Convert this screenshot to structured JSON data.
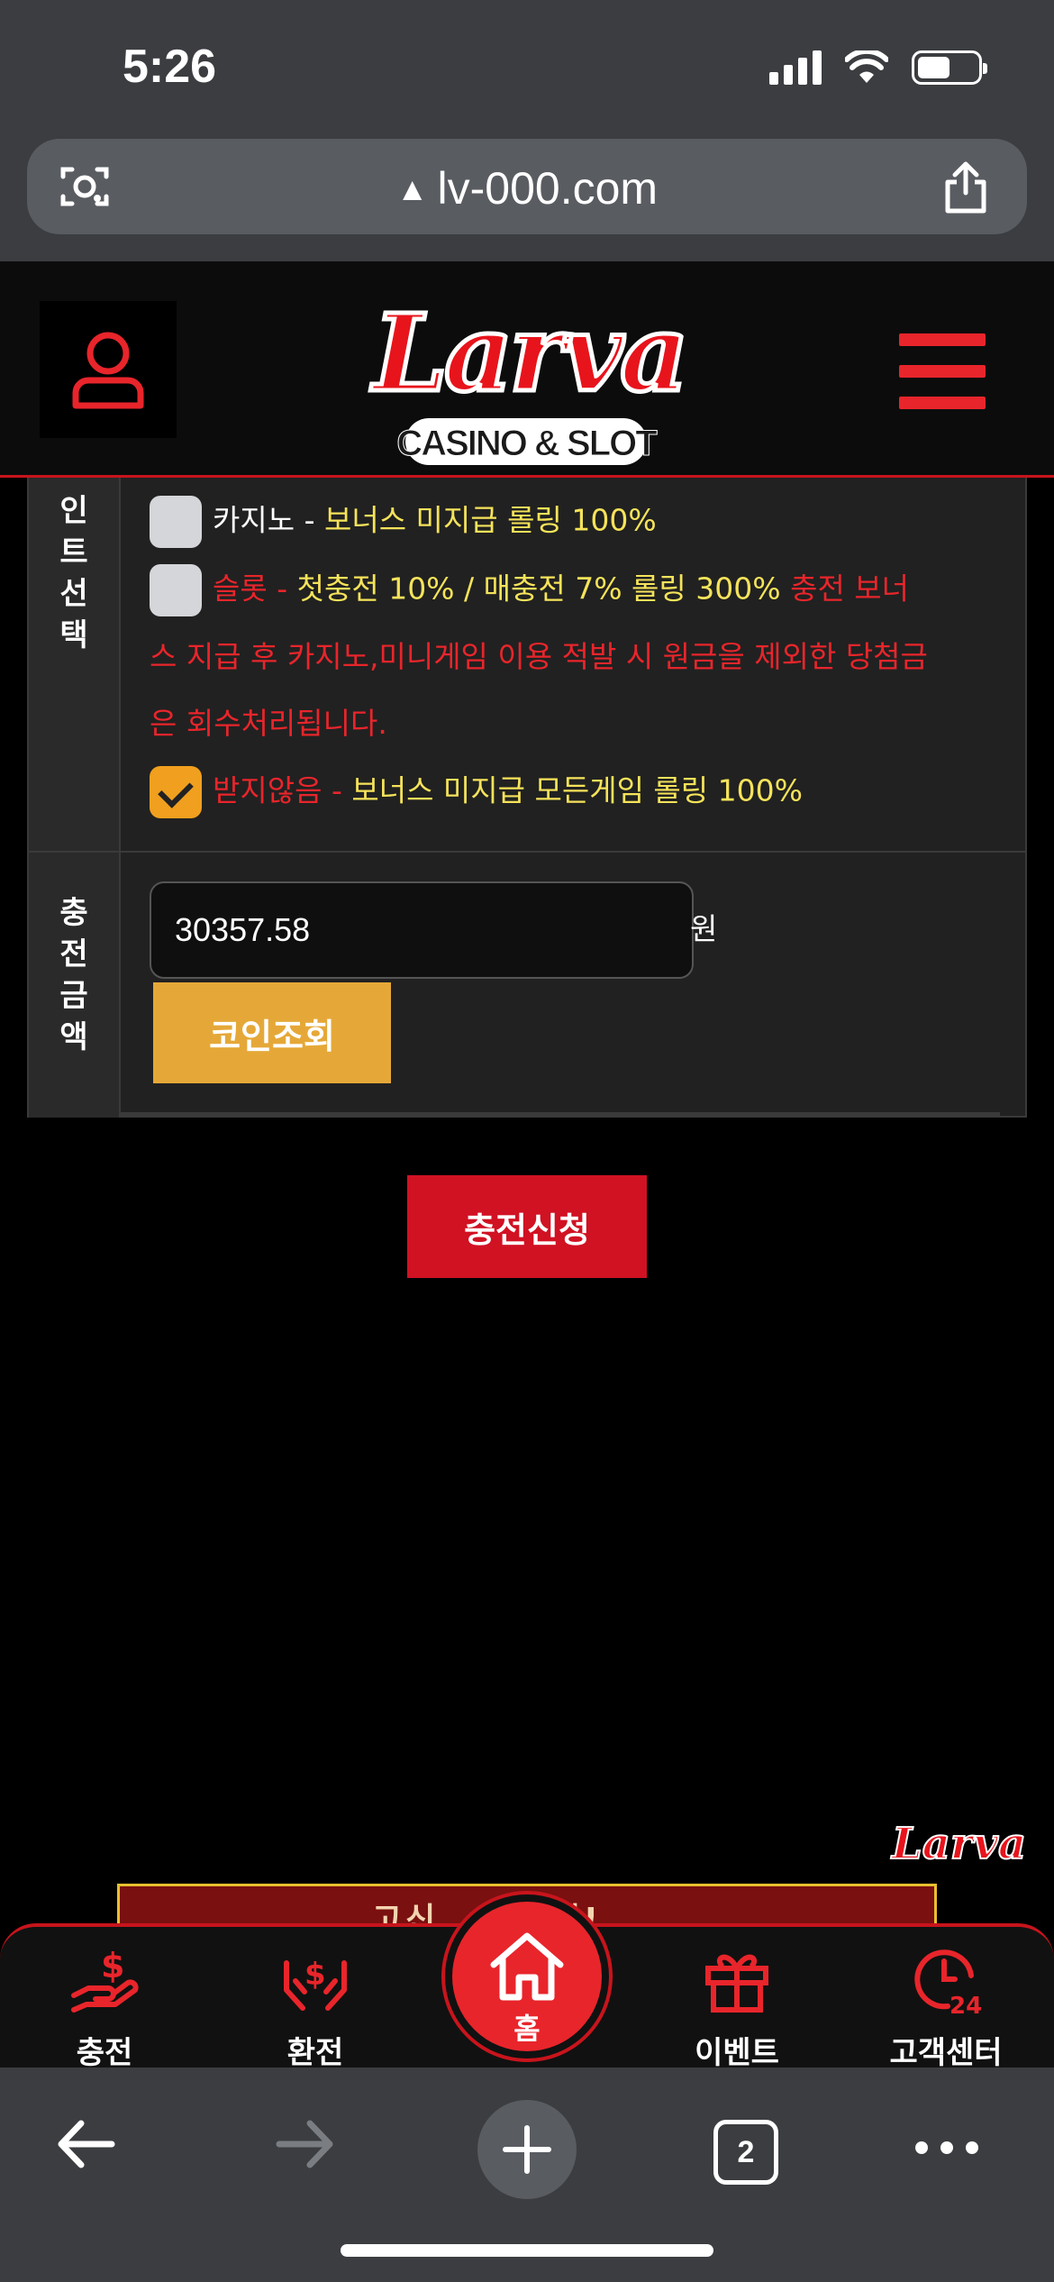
{
  "status_bar": {
    "time": "5:26"
  },
  "browser": {
    "url": "lv-000.com",
    "tab_count": "2"
  },
  "header": {
    "logo_text": "Larva",
    "logo_subtitle": "CASINO & SLOT",
    "icons": [
      "user-icon",
      "hamburger-menu-icon"
    ]
  },
  "form": {
    "point_select": {
      "label_chars": [
        "인",
        "트",
        "선",
        "택"
      ],
      "options": [
        {
          "name": "카지노",
          "separator": " - ",
          "desc": "보너스 미지급 롤링 100%",
          "checked": false
        },
        {
          "name": "슬롯",
          "separator": " - ",
          "desc": "첫충전 10% / 매충전 7% 롤링 300%",
          "warning_inline": " 충전 보너",
          "warning_line2": "스 지급 후 카지노,미니게임 이용 적발 시 원금을 제외한 당첨금",
          "warning_line3": "은 회수처리됩니다.",
          "checked": false
        },
        {
          "name": "받지않음",
          "separator": " - ",
          "desc": "보너스 미지급 모든게임 롤링 100%",
          "checked": true
        }
      ]
    },
    "amount": {
      "label_chars": [
        "충",
        "전",
        "금",
        "액"
      ],
      "value": "30357.58",
      "unit": "원",
      "coin_button": "코인조회"
    },
    "submit_button": "충전신청"
  },
  "floating_logo": "Larva",
  "banner_peek_text": "고신 ... 이벤!",
  "bottom_nav": [
    {
      "label": "충전",
      "icon": "deposit-icon"
    },
    {
      "label": "환전",
      "icon": "exchange-icon"
    },
    {
      "label": "홈",
      "icon": "home-icon"
    },
    {
      "label": "이벤트",
      "icon": "gift-icon"
    },
    {
      "label": "고객센터",
      "icon": "support-24-icon"
    }
  ],
  "colors": {
    "accent_red": "#e8252b",
    "yellow_text": "#f5e35a",
    "coin_button": "#e5a838",
    "submit_button": "#d01223"
  }
}
